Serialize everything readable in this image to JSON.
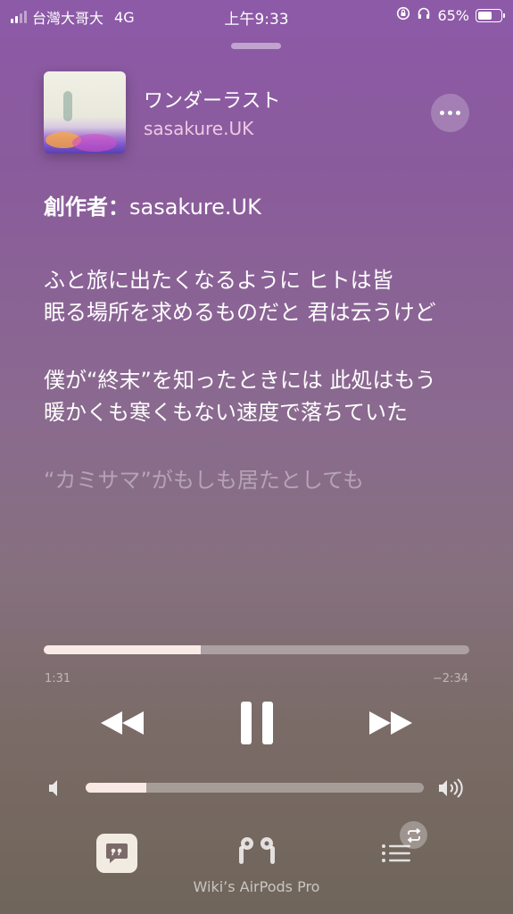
{
  "status_bar": {
    "carrier": "台灣大哥大",
    "network": "4G",
    "time": "上午9:33",
    "battery_percent": "65%",
    "battery_level": 0.65
  },
  "now_playing": {
    "title": "ワンダーラスト",
    "artist": "sasakure.UK",
    "credit_label": "創作者：",
    "credit_name": "sasakure.UK"
  },
  "lyrics": [
    "ふと旅に出たくなるように ヒトは皆",
    "眠る場所を求めるものだと 君は云うけど",
    "僕が“終末”を知ったときには 此処はもう",
    "暖かくも寒くもない速度で落ちていた",
    "“カミサマ”がもしも居たとしても"
  ],
  "playback": {
    "elapsed": "1:31",
    "remaining": "−2:34",
    "progress": 0.37
  },
  "volume": {
    "level": 0.18
  },
  "footer": {
    "device_name": "Wiki’s AirPods Pro"
  },
  "icons": {
    "lyrics": "quote-bubble-icon",
    "airplay": "airpods-icon",
    "queue": "list-icon",
    "repeat": "repeat-icon"
  }
}
